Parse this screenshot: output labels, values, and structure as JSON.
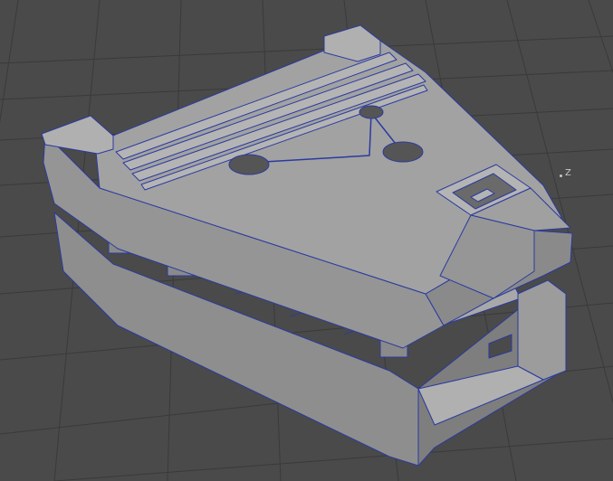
{
  "viewport": {
    "axis_label": "Z",
    "colors": {
      "background": "#4a4a4a",
      "grid": "#3a3a3a",
      "surface": "#9a9a9a",
      "surface_light": "#aaaaaa",
      "surface_dark": "#7e7e7e",
      "wireframe": "#2a3aa0"
    }
  }
}
